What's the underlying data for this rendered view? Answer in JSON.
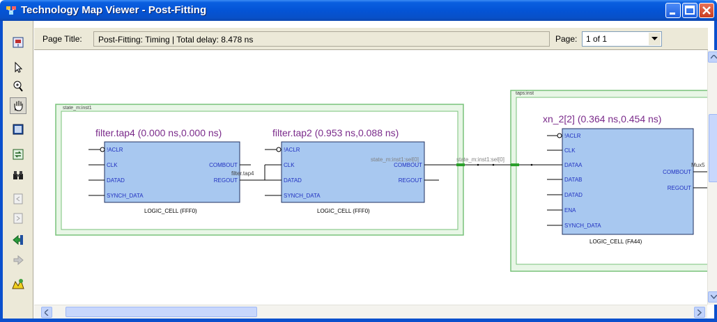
{
  "window": {
    "title": "Technology Map Viewer - Post-Fitting"
  },
  "header": {
    "page_title_label": "Page Title:",
    "page_title_value": "Post-Fitting: Timing | Total delay: 8.478 ns",
    "page_label": "Page:",
    "page_value": "1 of 1"
  },
  "toolbar": {
    "tools": [
      "hierarchy-up-icon",
      "select-pointer-icon",
      "zoom-icon",
      "hand-pan-icon",
      "fit-window-icon",
      "refresh-icon",
      "find-binoculars-icon",
      "previous-page-icon",
      "next-page-icon",
      "back-icon",
      "forward-icon",
      "properties-icon"
    ]
  },
  "diagram": {
    "group1_label": "state_m:inst1",
    "group2_label": "taps:inst",
    "cell1": {
      "name": "filter.tap4 (0.000 ns,0.000 ns)",
      "type": "LOGIC_CELL (FFF0)",
      "inputs": [
        "!ACLR",
        "CLK",
        "DATAD",
        "SYNCH_DATA"
      ],
      "outputs": [
        "COMBOUT",
        "REGOUT"
      ]
    },
    "cell2": {
      "name": "filter.tap2 (0.953 ns,0.088 ns)",
      "type": "LOGIC_CELL (FFF0)",
      "inputs": [
        "!ACLR",
        "CLK",
        "DATAD",
        "SYNCH_DATA"
      ],
      "outputs": [
        "COMBOUT",
        "REGOUT"
      ]
    },
    "cell3": {
      "name": "xn_2[2] (0.364 ns,0.454 ns)",
      "type": "LOGIC_CELL (FA44)",
      "inputs": [
        "!ACLR",
        "CLK",
        "DATAA",
        "DATAB",
        "DATAD",
        "ENA",
        "SYNCH_DATA"
      ],
      "outputs": [
        "COMBOUT",
        "REGOUT"
      ]
    },
    "net_label_1": "filter.tap4",
    "net_label_2": "state_m:inst1:sel[0]",
    "net_label_3": "state_m:inst1:sel[0]",
    "net_label_4": "Mux5",
    "colors": {
      "cell_fill": "#a8c8f0",
      "group_border": "#79c27a",
      "group_fill": "#e8f6e6",
      "title_blue": "#2c2c8c"
    }
  }
}
